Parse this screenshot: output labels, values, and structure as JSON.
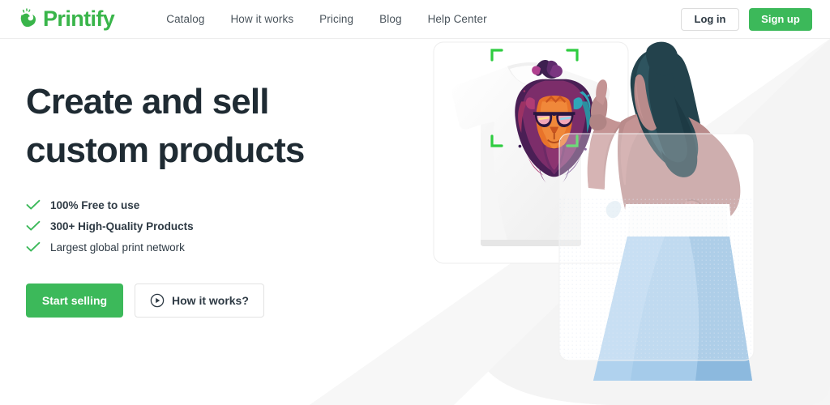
{
  "brand": {
    "name": "Printify",
    "logo_icon": "printify-hand-logo-icon",
    "green": "#3cb95a",
    "dark": "#1f2b33"
  },
  "header": {
    "nav": [
      {
        "label": "Catalog"
      },
      {
        "label": "How it works"
      },
      {
        "label": "Pricing"
      },
      {
        "label": "Blog"
      },
      {
        "label": "Help Center"
      }
    ],
    "login_label": "Log in",
    "signup_label": "Sign up"
  },
  "hero": {
    "title_line1": "Create and sell",
    "title_line2": "custom products",
    "bullets": [
      {
        "label": "100% Free to use",
        "icon": "check-icon",
        "bold": true
      },
      {
        "label": "300+ High-Quality Products",
        "icon": "check-icon",
        "bold": true
      },
      {
        "label": "Largest global print network",
        "icon": "check-icon",
        "bold": false
      }
    ],
    "primary_cta": "Start selling",
    "secondary_cta": "How it works?",
    "secondary_cta_icon": "play-circle-icon"
  },
  "illustration": {
    "product_card": "white t-shirt product mockup card",
    "design_icon": "lion-graphic-design",
    "selection_icon": "selection-corner-brackets",
    "selection_color": "#2ecc40",
    "person": "woman illustration pointing at shirt design",
    "colors": {
      "skin": "#b98b8b",
      "hair": "#23424c",
      "skirt": "#a5cbea",
      "top": "#ffffff",
      "backdrop": "#f4f4f4"
    }
  }
}
